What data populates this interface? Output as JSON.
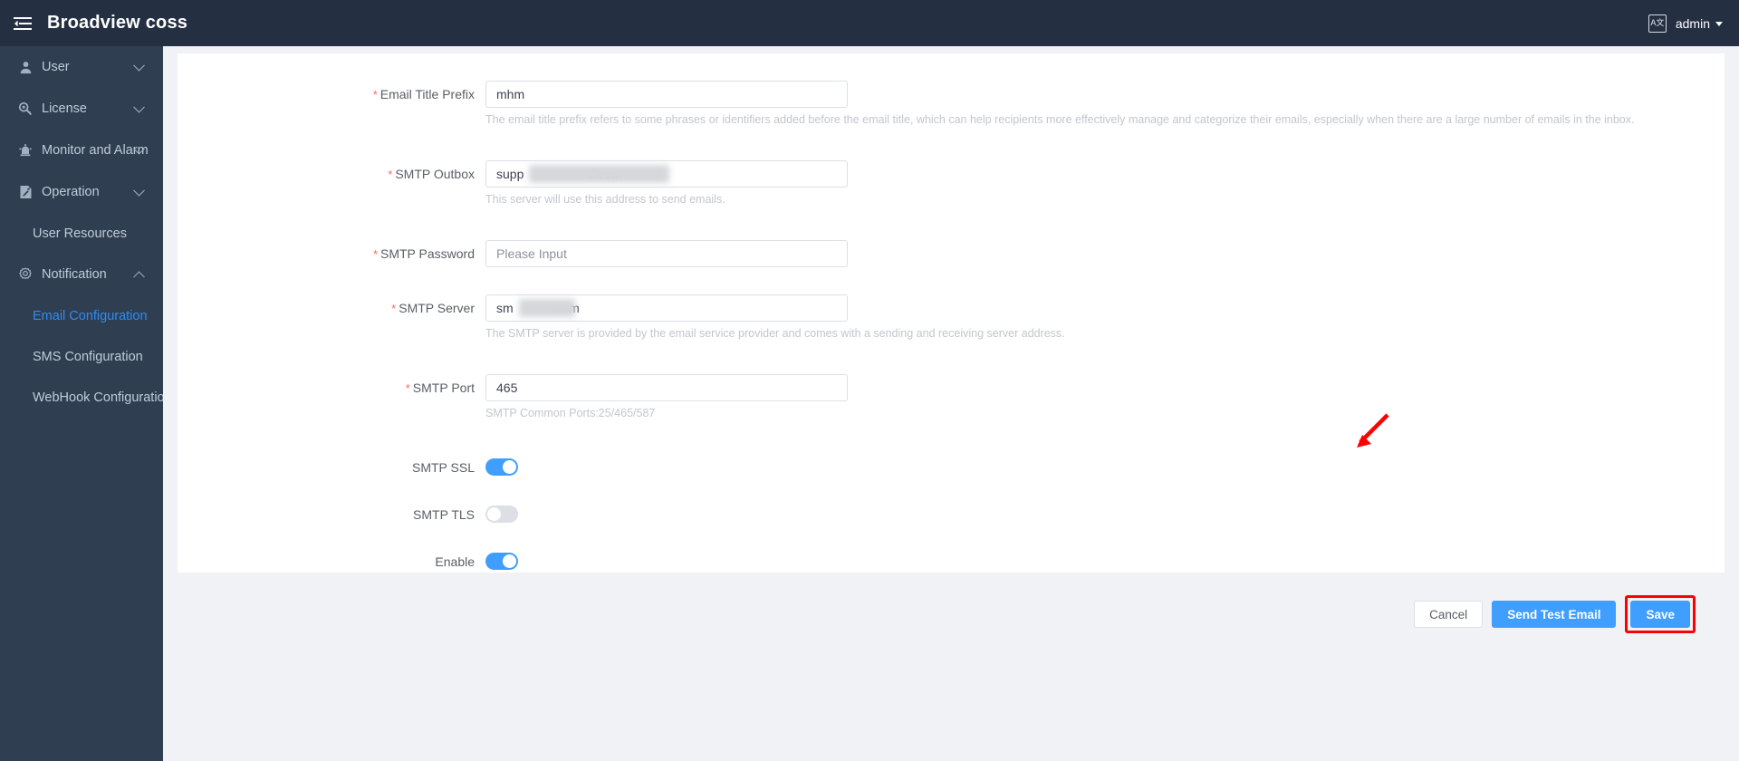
{
  "header": {
    "title": "Broadview coss",
    "collapse_icon": "hamburger-collapse-icon",
    "lang_icon_label": "A文",
    "user_name": "admin"
  },
  "sidebar": {
    "items": [
      {
        "label": "User",
        "icon": "user-icon",
        "expandable": true,
        "expanded": false
      },
      {
        "label": "License",
        "icon": "license-key-icon",
        "expandable": true,
        "expanded": false
      },
      {
        "label": "Monitor and Alarm",
        "icon": "alarm-bell-icon",
        "expandable": true,
        "expanded": false
      },
      {
        "label": "Operation",
        "icon": "wrench-document-icon",
        "expandable": true,
        "expanded": false
      }
    ],
    "operation_children": [
      {
        "label": "User Resources",
        "active": false
      }
    ],
    "notification": {
      "label": "Notification",
      "icon": "gear-icon",
      "expanded": true
    },
    "notification_children": [
      {
        "label": "Email Configuration",
        "active": true
      },
      {
        "label": "SMS Configuration",
        "active": false
      },
      {
        "label": "WebHook Configuration",
        "active": false
      }
    ]
  },
  "form": {
    "fields": [
      {
        "label": "Email Title Prefix",
        "required": true,
        "value": "mhm",
        "placeholder": "Please Input",
        "help": "The email title prefix refers to some phrases or identifiers added before the email title, which can help recipients more effectively manage and categorize their emails, especially when there are a large number of emails in the inbox.",
        "redacted": false
      },
      {
        "label": "SMTP Outbox",
        "required": true,
        "value": "supp                  d.com",
        "placeholder": "Please Input",
        "help": "This server will use this address to send emails.",
        "redacted": true
      },
      {
        "label": "SMTP Password",
        "required": true,
        "value": "",
        "placeholder": "Please Input",
        "help": "",
        "redacted": false
      },
      {
        "label": "SMTP Server",
        "required": true,
        "value": "sm           .com",
        "placeholder": "Please Input",
        "help": "The SMTP server is provided by the email service provider and comes with a sending and receiving server address.",
        "redacted": true
      },
      {
        "label": "SMTP Port",
        "required": true,
        "value": "465",
        "placeholder": "Please Input",
        "help": "SMTP Common Ports:25/465/587",
        "redacted": false
      }
    ],
    "switches": [
      {
        "label": "SMTP SSL",
        "on": true
      },
      {
        "label": "SMTP TLS",
        "on": false
      },
      {
        "label": "Enable",
        "on": true
      }
    ]
  },
  "buttons": {
    "cancel": "Cancel",
    "send_test_email": "Send Test Email",
    "save": "Save"
  },
  "annotation": {
    "arrow_color": "#ff0000",
    "highlight_target": "Save"
  },
  "colors": {
    "header_bg": "#242f42",
    "sidebar_bg": "#303e52",
    "accent": "#409eff",
    "active_nav": "#2d8cf0",
    "required_star": "#f56c6c",
    "annotation_red": "#ff0000",
    "page_bg": "#f0f2f5"
  }
}
